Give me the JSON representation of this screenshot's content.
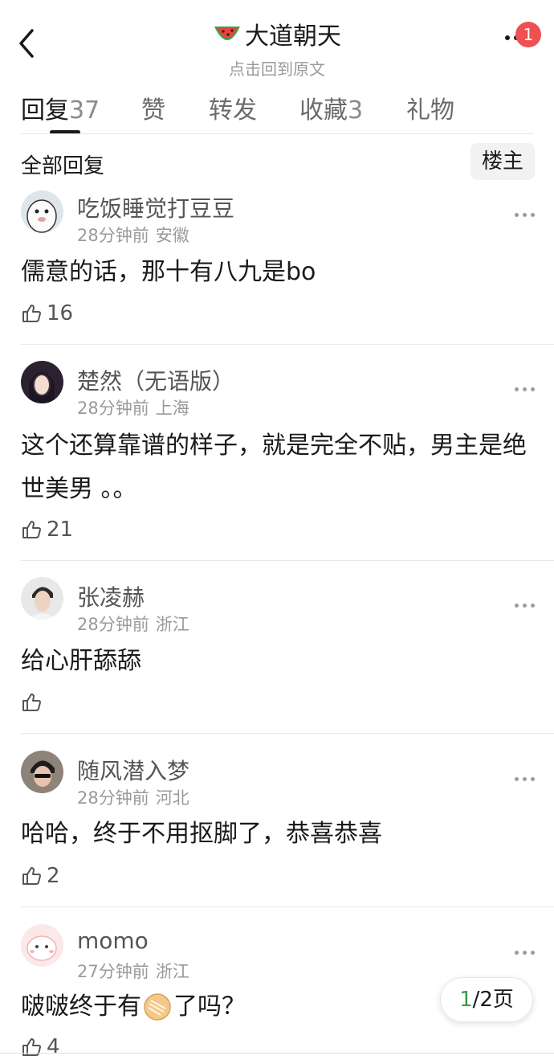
{
  "header": {
    "title": "大道朝天",
    "title_icon": "watermelon-icon",
    "subtitle": "点击回到原文",
    "badge_count": "1"
  },
  "tabs": [
    {
      "label": "回复",
      "count": "37",
      "active": true
    },
    {
      "label": "赞",
      "count": "",
      "active": false
    },
    {
      "label": "转发",
      "count": "",
      "active": false
    },
    {
      "label": "收藏",
      "count": "3",
      "active": false
    },
    {
      "label": "礼物",
      "count": "",
      "active": false
    }
  ],
  "filter": {
    "title": "全部回复",
    "owner_button": "楼主"
  },
  "comments": [
    {
      "user": "吃饭睡觉打豆豆",
      "time": "28分钟前",
      "location": "安徽",
      "text": "儒意的话，那十有八九是bo",
      "likes": "16"
    },
    {
      "user": "楚然（无语版）",
      "time": "28分钟前",
      "location": "上海",
      "text": "这个还算靠谱的样子，就是完全不贴，男主是绝世美男 。。",
      "likes": "21"
    },
    {
      "user": "张凌赫",
      "time": "28分钟前",
      "location": "浙江",
      "text": "给心肝舔舔",
      "likes": ""
    },
    {
      "user": "随风潜入梦",
      "time": "28分钟前",
      "location": "河北",
      "text": "哈哈，终于不用抠脚了，恭喜恭喜",
      "likes": "2"
    },
    {
      "user": "momo",
      "time": "27分钟前",
      "location": "浙江",
      "text_before": "啵啵终于有",
      "emoji": "pancake-emoji",
      "text_after": "了吗？",
      "likes": "4"
    }
  ],
  "pagination": {
    "current": "1",
    "total_text": "/2页"
  },
  "colors": {
    "badge": "#f05050",
    "page_current": "#3d9a4a",
    "muted": "#9a9a9a"
  }
}
